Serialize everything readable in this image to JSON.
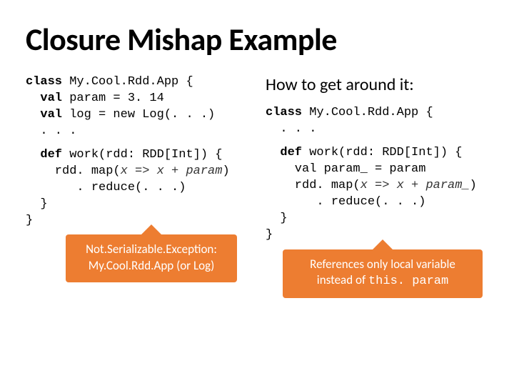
{
  "title": "Closure Mishap Example",
  "left": {
    "code1_kw1": "class",
    "code1_l1b": " My.Cool.Rdd.App {",
    "code1_kw2": "  val",
    "code1_l2b": " param = 3. 14",
    "code1_kw3": "  val",
    "code1_l3b": " log = new Log(. . .)",
    "code1_l4": "  . . .",
    "code2_kw1": "  def",
    "code2_l1b": " work(rdd: RDD[Int]) {",
    "code2_l2a": "    rdd. map(",
    "code2_arg": "x => x + param",
    "code2_l2c": ")",
    "code2_l3": "       . reduce(. . .)",
    "code2_l4": "  }",
    "code2_l5": "}",
    "callout_l1": "Not.Serializable.Exception:",
    "callout_l2": "My.Cool.Rdd.App (or Log)"
  },
  "right": {
    "subhead": "How to get around it:",
    "code1_kw1": "class",
    "code1_l1b": " My.Cool.Rdd.App {",
    "code1_l2": "  . . .",
    "code2_kw1": "  def",
    "code2_l1b": " work(rdd: RDD[Int]) {",
    "code2_l2": "    val param_ = param",
    "code2_l3a": "    rdd. map(",
    "code2_arg": "x => x + param_",
    "code2_l3c": ")",
    "code2_l4": "       . reduce(. . .)",
    "code2_l5": "  }",
    "code2_l6": "}",
    "callout_l1": "References only local variable",
    "callout_l2a": "instead of ",
    "callout_l2b": "this. param"
  }
}
